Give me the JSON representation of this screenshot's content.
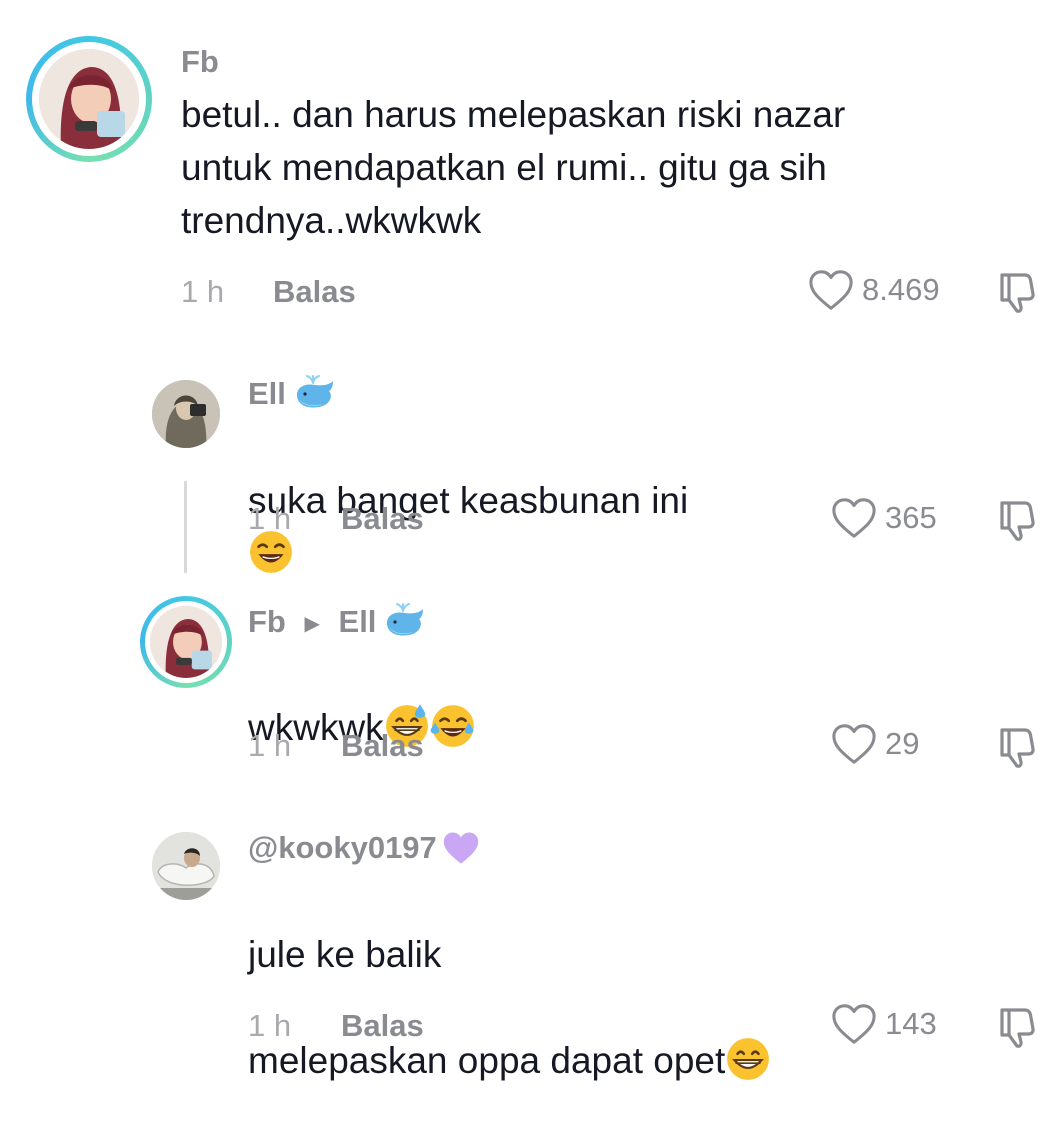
{
  "comments": [
    {
      "username": "Fb",
      "text": "betul.. dan harus melepaskan riski nazar\nuntuk mendapatkan el rumi.. gitu ga sih\ntrendnya..wkwkwk",
      "time": "1 h",
      "reply_label": "Balas",
      "likes": "8.469"
    },
    {
      "username": "Ell",
      "text": "suka banget keasbunan ini",
      "time": "1 h",
      "reply_label": "Balas",
      "likes": "365"
    },
    {
      "username": "Fb",
      "reply_to": "Ell",
      "text": "wkwkwk",
      "time": "1 h",
      "reply_label": "Balas",
      "likes": "29"
    },
    {
      "username": "@kooky0197",
      "text_line1": "jule ke balik",
      "text_line2": "melepaskan oppa dapat opet",
      "time": "1 h",
      "reply_label": "Balas",
      "likes": "143"
    }
  ],
  "icons": {
    "like": "heart-outline-icon",
    "dislike": "thumbs-down-icon",
    "whale_emoji": "whale-icon",
    "purple_heart": "purple-heart-icon",
    "rofl": "rolling-laughing-icon",
    "grin_sweat": "grinning-sweat-icon",
    "tears_joy": "tears-of-joy-icon",
    "grin": "grinning-icon"
  },
  "colors": {
    "story_ring": "#41c8e6",
    "muted_text": "#8a8b91",
    "body_text": "#161823"
  }
}
